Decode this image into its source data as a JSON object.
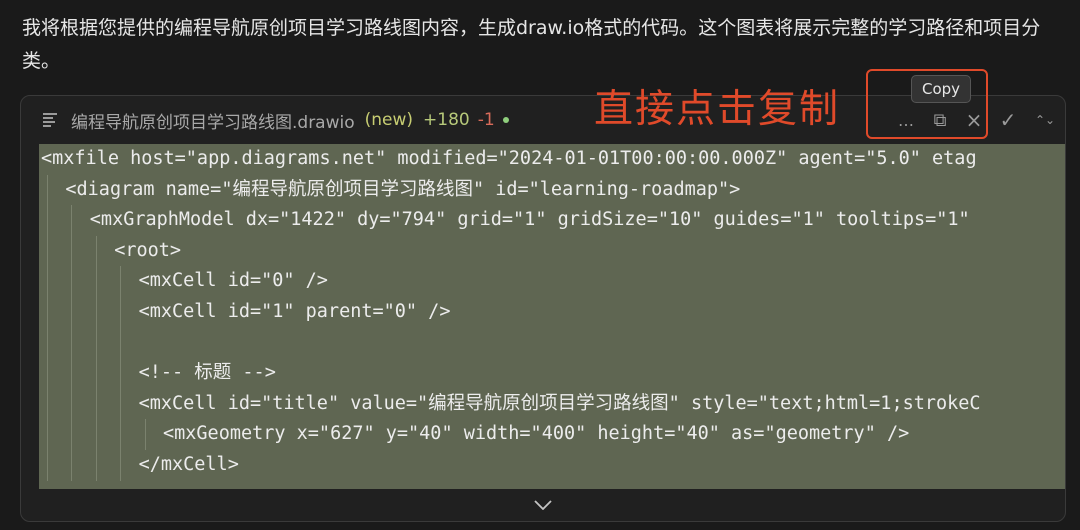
{
  "intro_text": "我将根据您提供的编程导航原创项目学习路线图内容，生成draw.io格式的代码。这个图表将展示完整的学习路径和项目分类。",
  "file": {
    "name": "编程导航原创项目学习路线图.drawio",
    "badge": "(new)",
    "added": "+180",
    "removed": "-1"
  },
  "toolbar": {
    "more_icon": "…",
    "copy_icon": "⧉",
    "close_icon": "×",
    "accept_icon": "✓",
    "expand_icon": "⌃⌄"
  },
  "tooltip": "Copy",
  "annotation": "直接点击复制",
  "code_lines": [
    {
      "indent": 0,
      "text": "<mxfile host=\"app.diagrams.net\" modified=\"2024-01-01T00:00:00.000Z\" agent=\"5.0\" etag"
    },
    {
      "indent": 1,
      "text": "<diagram name=\"编程导航原创项目学习路线图\" id=\"learning-roadmap\">"
    },
    {
      "indent": 2,
      "text": "<mxGraphModel dx=\"1422\" dy=\"794\" grid=\"1\" gridSize=\"10\" guides=\"1\" tooltips=\"1\""
    },
    {
      "indent": 3,
      "text": "<root>"
    },
    {
      "indent": 4,
      "text": "<mxCell id=\"0\" />"
    },
    {
      "indent": 4,
      "text": "<mxCell id=\"1\" parent=\"0\" />"
    },
    {
      "indent": 4,
      "text": ""
    },
    {
      "indent": 4,
      "text": "<!-- 标题 -->"
    },
    {
      "indent": 4,
      "text": "<mxCell id=\"title\" value=\"编程导航原创项目学习路线图\" style=\"text;html=1;strokeC"
    },
    {
      "indent": 5,
      "text": "<mxGeometry x=\"627\" y=\"40\" width=\"400\" height=\"40\" as=\"geometry\" />"
    },
    {
      "indent": 4,
      "text": "</mxCell>"
    }
  ]
}
